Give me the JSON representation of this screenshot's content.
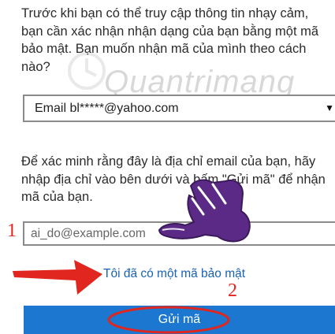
{
  "intro_text": "Trước khi bạn có thể truy cập thông tin nhạy cảm, bạn cần xác nhận nhận dạng của bạn bằng một mã bảo mật. Bạn muốn nhận mã của mình theo cách nào?",
  "method_select": {
    "value": "Email bl*****@yahoo.com"
  },
  "verify_text": "Để xác minh rằng đây là địa chỉ email của bạn, hãy nhập địa chỉ vào bên dưới và bấm \"Gửi mã\" để nhận mã của bạn.",
  "email_input": {
    "placeholder": "ai_do@example.com"
  },
  "have_code_link": "Tôi đã có một mã bảo mật",
  "send_button": "Gửi mã",
  "annotations": {
    "step1": "1",
    "step2": "2"
  },
  "watermark": "Quantrimang",
  "colors": {
    "accent": "#1b77cf",
    "link": "#1a62b4",
    "annotation": "#e0261f"
  }
}
